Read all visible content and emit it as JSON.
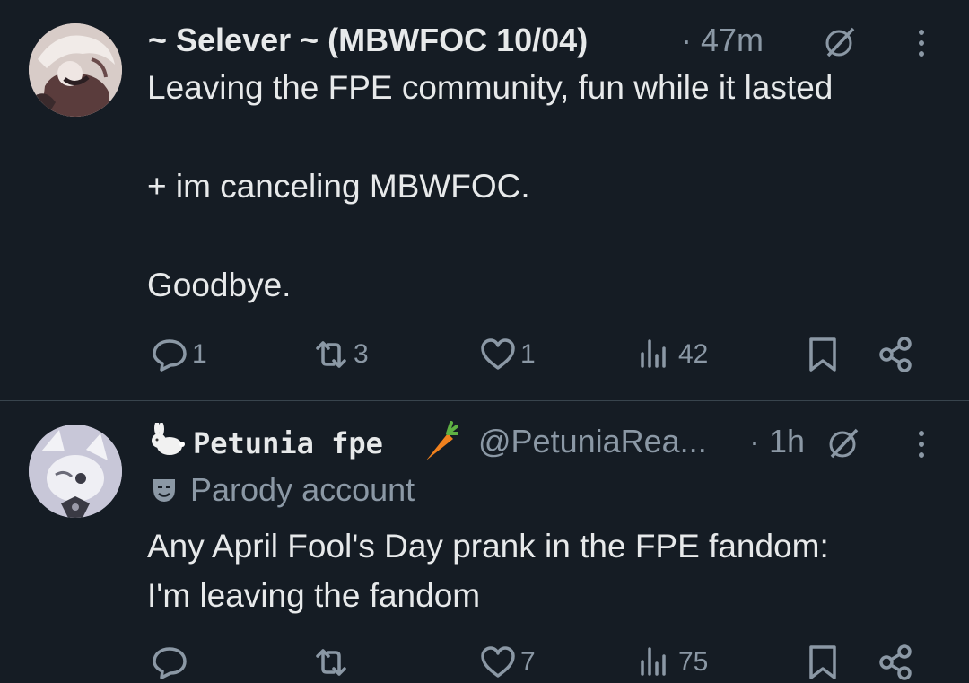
{
  "tweets": [
    {
      "display_name": "~ Selever ~ (MBWFOC 10/04)",
      "time": "· 47m",
      "text": "Leaving the FPE community, fun while it lasted\n\n+ im canceling MBWFOC.\n\nGoodbye.",
      "replies": "1",
      "reposts": "3",
      "likes": "1",
      "views": "42"
    },
    {
      "display_name": "Petunia fpe",
      "handle": "@PetuniaRea...",
      "time": "· 1h",
      "badge": "Parody account",
      "text": "Any April Fool's Day prank in the FPE fandom:\nI'm leaving the fandom",
      "replies": "",
      "reposts": "",
      "likes": "7",
      "views": "75"
    }
  ],
  "icons": {
    "reply": "speech-bubble-icon",
    "repost": "repost-arrows-icon",
    "like": "heart-icon",
    "views": "bar-chart-icon",
    "bookmark": "bookmark-icon",
    "share": "share-icon",
    "grok": "grok-slash-icon",
    "more": "vertical-dots-icon",
    "parody": "theater-mask-icon",
    "rabbit": "rabbit-emoji",
    "carrot": "carrot-emoji"
  },
  "colors": {
    "background": "#151c24",
    "text": "#e7e9ea",
    "secondary": "#8b98a5",
    "divider": "#38444d"
  }
}
